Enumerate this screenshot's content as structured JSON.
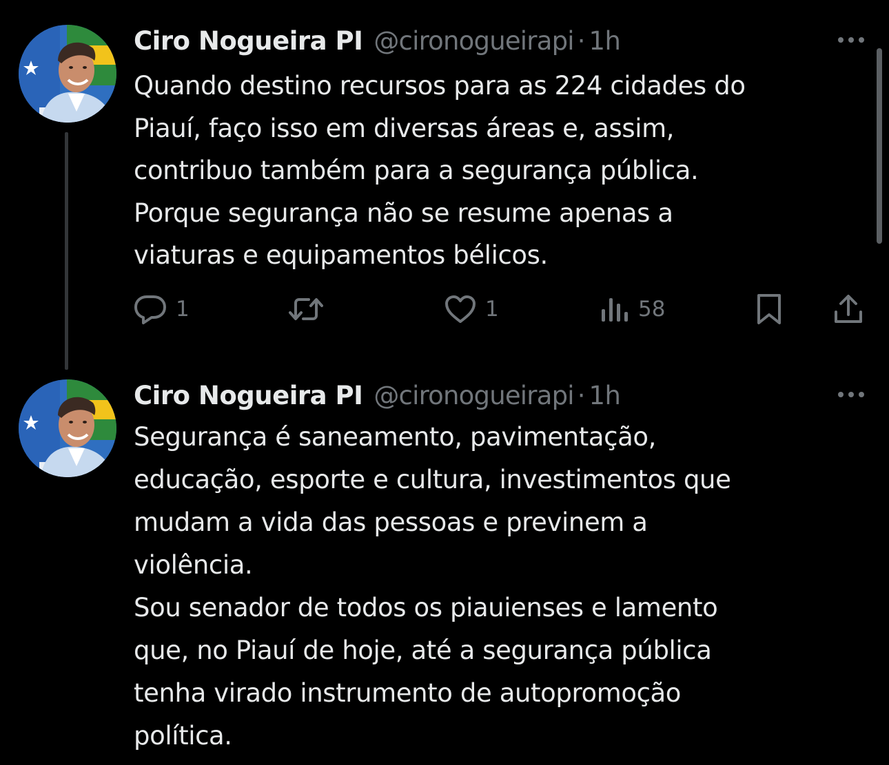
{
  "tweets": [
    {
      "author": {
        "display_name": "Ciro Nogueira PI",
        "handle": "@cironogueirapi",
        "time": "1h",
        "avatar_icon": "profile-photo"
      },
      "text_lines": [
        "Quando destino recursos para as 224 cidades do",
        "Piauí, faço isso em diversas áreas e, assim,",
        "contribuo também para a segurança pública.",
        "Porque segurança não se resume apenas a",
        "viaturas e equipamentos bélicos."
      ],
      "actions": {
        "reply_count": "1",
        "retweet_count": "",
        "like_count": "1",
        "views_count": "58"
      }
    },
    {
      "author": {
        "display_name": "Ciro Nogueira PI",
        "handle": "@cironogueirapi",
        "time": "1h",
        "avatar_icon": "profile-photo"
      },
      "text_lines": [
        "Segurança é saneamento, pavimentação,",
        "educação, esporte e cultura, investimentos que",
        "mudam a vida das pessoas e previnem a",
        "violência.",
        "Sou senador de todos os piauienses e lamento",
        "que, no Piauí de hoje, até a segurança pública",
        "tenha virado instrumento de autopromoção",
        "política."
      ]
    }
  ],
  "separator": "·",
  "colors": {
    "background": "#000000",
    "text_primary": "#e7e9ea",
    "text_secondary": "#71767b",
    "thread_line": "#333639"
  }
}
